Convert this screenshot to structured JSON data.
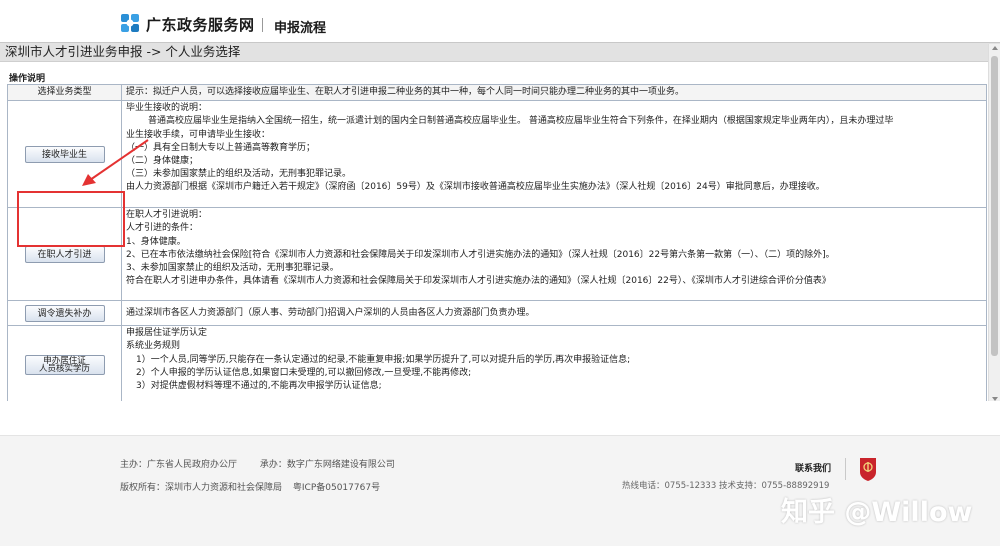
{
  "header": {
    "site_name": "广东政务服务网",
    "subtitle": "申报流程"
  },
  "breadcrumb": "深圳市人才引进业务申报 -> 个人业务选择",
  "section_label": "操作说明",
  "table": {
    "head": {
      "col1": "选择业务类型",
      "col2": "提示：拟迁户人员，可以选择接收应届毕业生、在职人才引进申报二种业务的其中一种，每个人同一时间只能办理二种业务的其中一项业务。"
    },
    "rows": [
      {
        "button": "接收毕业生",
        "lines": [
          "毕业生接收的说明：",
          "普通高校应届毕业生是指纳入全国统一招生，统一派遣计划的国内全日制普通高校应届毕业生。 普通高校应届毕业生符合下列条件，在择业期内（根据国家规定毕业两年内），且未办理过毕",
          "业生接收手续，可申请毕业生接收：",
          "（一）具有全日制大专以上普通高等教育学历；",
          "（二）身体健康；",
          "（三）未参加国家禁止的组织及活动，无刑事犯罪记录。",
          "由人力资源部门根据《深圳市户籍迁入若干规定》（深府函〔2016〕59号）及《深圳市接收普通高校应届毕业生实施办法》（深人社规〔2016〕24号）审批同意后，办理接收。"
        ]
      },
      {
        "button": "在职人才引进",
        "lines": [
          "在职人才引进说明：",
          "人才引进的条件：",
          "1、身体健康。",
          "2、已在本市依法缴纳社会保险[符合《深圳市人力资源和社会保障局关于印发深圳市人才引进实施办法的通知》（深人社规〔2016〕22号第六条第一款第（一）、（二）项的除外]。",
          "3、未参加国家禁止的组织及活动，无刑事犯罪记录。",
          "符合在职人才引进申办条件，具体请看《深圳市人力资源和社会保障局关于印发深圳市人才引进实施办法的通知》（深人社规〔2016〕22号）、《深圳市人才引进综合评价分值表》"
        ]
      },
      {
        "button": "调令遗失补办",
        "lines": [
          "通过深圳市各区人力资源部门（原人事、劳动部门)招调入户深圳的人员由各区人力资源部门负责办理。"
        ]
      },
      {
        "button_line1": "申办居住证",
        "button_line2": "人员核实学历",
        "lines": [
          "申报居住证学历认定",
          "系统业务规则",
          "1）一个人员,同等学历,只能存在一条认定通过的纪录,不能重复申报;如果学历提升了,可以对提升后的学历,再次申报验证信息;",
          "2）个人申报的学历认证信息,如果窗口未受理的,可以撤回修改,一旦受理,不能再修改;",
          "3）对提供虚假材料等理不通过的,不能再次申报学历认证信息;"
        ]
      }
    ]
  },
  "footer": {
    "host": "主办：广东省人民政府办公厅",
    "undertaker": "承办：数字广东网络建设有限公司",
    "copyright": "版权所有：深圳市人力资源和社会保障局",
    "icp": "粤ICP备05017767号",
    "contact_title": "联系我们",
    "contact_tel": "热线电话：0755-12333 技术支持：0755-88892919"
  },
  "watermark": "知乎 @Willow",
  "colors": {
    "highlight_box": "#e43232",
    "table_border": "#aab6c6",
    "breadcrumb_bg": "#e2e2e2"
  }
}
